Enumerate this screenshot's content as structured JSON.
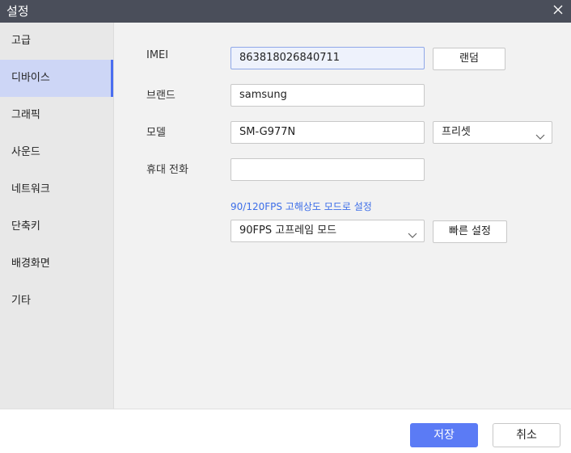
{
  "window": {
    "title": "설정"
  },
  "sidebar": {
    "items": [
      {
        "label": "고급"
      },
      {
        "label": "디바이스"
      },
      {
        "label": "그래픽"
      },
      {
        "label": "사운드"
      },
      {
        "label": "네트워크"
      },
      {
        "label": "단축키"
      },
      {
        "label": "배경화면"
      },
      {
        "label": "기타"
      }
    ],
    "active_index": 1
  },
  "device": {
    "imei": {
      "label": "IMEI",
      "value": "863818026840711",
      "button": "랜덤"
    },
    "brand": {
      "label": "브랜드",
      "value": "samsung"
    },
    "model": {
      "label": "모델",
      "value": "SM-G977N",
      "preset": "프리셋"
    },
    "phone": {
      "label": "휴대 전화",
      "value": ""
    },
    "fps_link": "90/120FPS 고해상도 모드로 설정",
    "fps_select": "90FPS 고프레임 모드",
    "quick_button": "빠른 설정"
  },
  "footer": {
    "save": "저장",
    "cancel": "취소"
  },
  "colors": {
    "titlebar": "#4a4e5a",
    "accent": "#5b7bf5",
    "active_item": "#cdd6f6",
    "link": "#3d6ee8"
  }
}
